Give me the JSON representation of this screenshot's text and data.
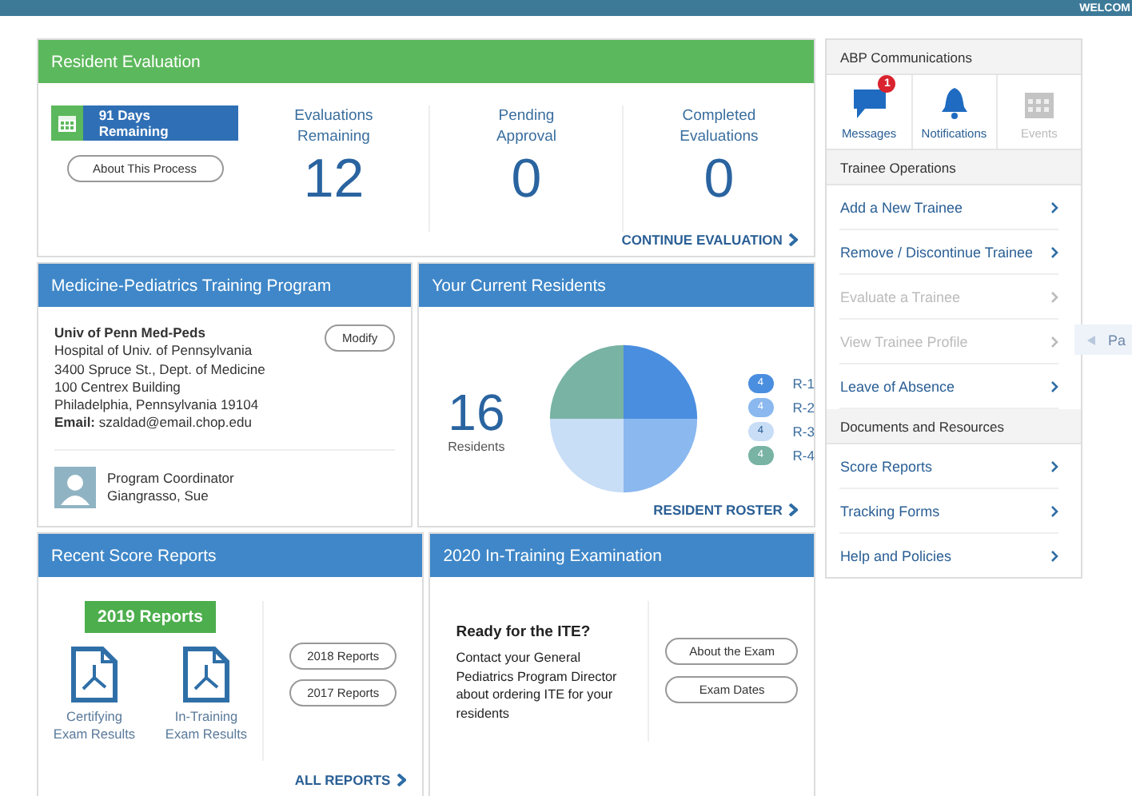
{
  "top_bar": {
    "welcome": "WELCOM"
  },
  "evaluation": {
    "title": "Resident Evaluation",
    "days_badge": "91 Days Remaining",
    "about_button": "About This Process",
    "stats": [
      {
        "label": "Evaluations Remaining",
        "value": "12"
      },
      {
        "label": "Pending Approval",
        "value": "0"
      },
      {
        "label": "Completed Evaluations",
        "value": "0"
      }
    ],
    "link": "CONTINUE EVALUATION"
  },
  "program": {
    "title": "Medicine-Pediatrics Training Program",
    "name": "Univ of Penn Med-Peds",
    "address_lines": [
      "Hospital of Univ. of Pennsylvania",
      "3400 Spruce St., Dept. of Medicine",
      "100 Centrex Building",
      "Philadelphia, Pennsylvania 19104"
    ],
    "email_label": "Email:",
    "email": "szaldad@email.chop.edu",
    "modify_button": "Modify",
    "coordinator_role": "Program Coordinator",
    "coordinator_name": "Giangrasso, Sue"
  },
  "residents": {
    "title": "Your Current Residents",
    "count": "16",
    "count_label": "Residents",
    "legend": [
      {
        "label": "R-1",
        "badge": "4",
        "color": "#4a8ee0"
      },
      {
        "label": "R-2",
        "badge": "4",
        "color": "#8ab8ef"
      },
      {
        "label": "R-3",
        "badge": "4",
        "color": "#c8ddf6"
      },
      {
        "label": "R-4",
        "badge": "4",
        "color": "#78b3a4"
      }
    ],
    "link": "RESIDENT ROSTER"
  },
  "score_reports": {
    "title": "Recent Score Reports",
    "current_button": "2019 Reports",
    "files": [
      {
        "label": "Certifying Exam Results"
      },
      {
        "label": "In-Training Exam Results"
      }
    ],
    "year_buttons": [
      "2018 Reports",
      "2017 Reports"
    ],
    "link": "ALL REPORTS"
  },
  "exam": {
    "title": "2020 In-Training Examination",
    "heading": "Ready for the ITE?",
    "text": "Contact your General Pediatrics Program Director about ordering ITE for your residents",
    "buttons": [
      "About the Exam",
      "Exam Dates"
    ]
  },
  "side_panel": {
    "communications_title": "ABP Communications",
    "tiles": [
      {
        "kind": "messages",
        "label": "Messages",
        "badge": "1",
        "disabled": false
      },
      {
        "kind": "notifications",
        "label": "Notifications",
        "disabled": false
      },
      {
        "kind": "events",
        "label": "Events",
        "disabled": true
      }
    ],
    "sections": [
      {
        "title": "Trainee Operations",
        "items": [
          {
            "label": "Add a New Trainee",
            "disabled": false
          },
          {
            "label": "Remove / Discontinue Trainee",
            "disabled": false
          },
          {
            "label": "Evaluate a Trainee",
            "disabled": true
          },
          {
            "label": "View Trainee Profile",
            "disabled": true
          },
          {
            "label": "Leave of Absence",
            "disabled": false
          }
        ]
      },
      {
        "title": "Documents and Resources",
        "items": [
          {
            "label": "Score Reports",
            "disabled": false
          },
          {
            "label": "Tracking Forms",
            "disabled": false
          },
          {
            "label": "Help and Policies",
            "disabled": false
          }
        ]
      }
    ]
  },
  "side_tab": {
    "label": "Pa"
  }
}
